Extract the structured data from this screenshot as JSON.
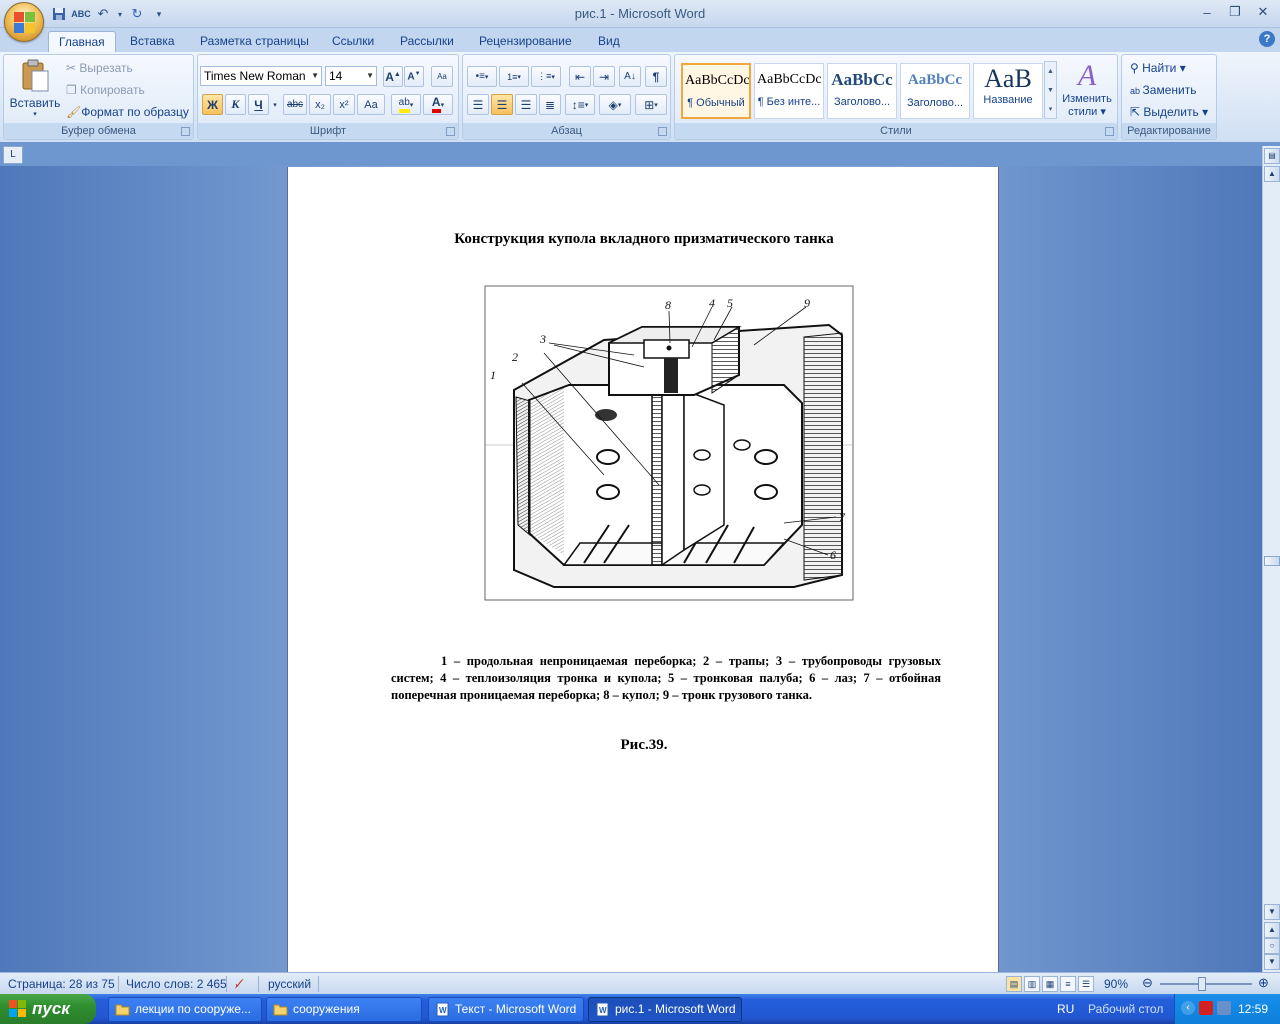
{
  "window": {
    "title": "рис.1 - Microsoft Word"
  },
  "tabs": [
    "Главная",
    "Вставка",
    "Разметка страницы",
    "Ссылки",
    "Рассылки",
    "Рецензирование",
    "Вид"
  ],
  "clipboard": {
    "paste": "Вставить",
    "cut": "Вырезать",
    "copy": "Копировать",
    "format_painter": "Формат по образцу",
    "label": "Буфер обмена"
  },
  "font": {
    "name": "Times New Roman",
    "size": "14",
    "label": "Шрифт",
    "bold": "Ж",
    "italic": "К",
    "underline": "Ч",
    "strike": "abc",
    "sub": "x₂",
    "sup": "x²",
    "case": "Aa"
  },
  "paragraph": {
    "label": "Абзац",
    "pilcrow": "¶"
  },
  "styles": {
    "label": "Стили",
    "items": [
      {
        "sample": "AaBbCcDc",
        "name": "¶ Обычный"
      },
      {
        "sample": "AaBbCcDc",
        "name": "¶ Без инте..."
      },
      {
        "sample": "AaBbCc",
        "name": "Заголово..."
      },
      {
        "sample": "AaBbCc",
        "name": "Заголово..."
      },
      {
        "sample": "AaB",
        "name": "Название"
      }
    ],
    "change": "Изменить",
    "change2": "стили"
  },
  "editing": {
    "find": "Найти",
    "replace": "Заменить",
    "select": "Выделить",
    "label": "Редактирование"
  },
  "document": {
    "title": "Конструкция купола вкладного призматического танка",
    "caption": "1 – продольная непроницаемая переборка; 2 – трапы; 3 – трубопроводы грузовых систем; 4 – теплоизоляция тронка и купола; 5 – тронковая палуба; 6 – лаз; 7 – отбойная поперечная проницаемая переборка; 8 – купол; 9 – тронк грузового танка.",
    "figure_number": "Рис.39.",
    "figure_labels": [
      "1",
      "2",
      "3",
      "4",
      "5",
      "6",
      "7",
      "8",
      "9"
    ]
  },
  "status": {
    "page": "Страница: 28 из 75",
    "words": "Число слов: 2 465",
    "language": "русский",
    "zoom": "90%"
  },
  "taskbar": {
    "start": "пуск",
    "tasks": [
      "лекции по сооруже...",
      "сооружения",
      "Текст - Microsoft Word",
      "рис.1 - Microsoft Word"
    ],
    "lang": "RU",
    "desktop": "Рабочий стол",
    "clock": "12:59"
  },
  "colors": {
    "accent": "#15428b",
    "taskbar": "#245edb",
    "start": "#2f8f2f",
    "selected_style": "#f1a73c"
  }
}
